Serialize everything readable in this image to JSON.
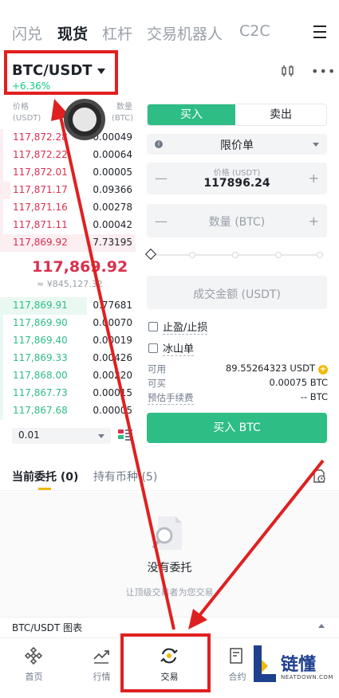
{
  "top_tabs": [
    "闪兑",
    "现货",
    "杠杆",
    "交易机器人",
    "C2C"
  ],
  "pair": {
    "symbol": "BTC/USDT",
    "change": "+6.36%"
  },
  "orderbook": {
    "price_header": "价格",
    "price_unit": "(USDT)",
    "qty_header": "数量",
    "qty_unit": "(BTC)",
    "asks": [
      {
        "price": "117,872.28",
        "qty": "0.00049"
      },
      {
        "price": "117,872.22",
        "qty": "0.00064"
      },
      {
        "price": "117,872.01",
        "qty": "0.00005"
      },
      {
        "price": "117,871.17",
        "qty": "0.09366"
      },
      {
        "price": "117,871.16",
        "qty": "0.00278"
      },
      {
        "price": "117,871.11",
        "qty": "0.00042"
      },
      {
        "price": "117,869.92",
        "qty": "7.73195"
      }
    ],
    "last_price": "117,869.92",
    "last_price_fiat": "≈ ¥845,127.32",
    "bids": [
      {
        "price": "117,869.91",
        "qty": "0.77681"
      },
      {
        "price": "117,869.90",
        "qty": "0.00070"
      },
      {
        "price": "117,869.40",
        "qty": "0.00019"
      },
      {
        "price": "117,869.33",
        "qty": "0.00426"
      },
      {
        "price": "117,868.00",
        "qty": "0.00220"
      },
      {
        "price": "117,867.73",
        "qty": "0.00015"
      },
      {
        "price": "117,867.68",
        "qty": "0.00005"
      }
    ],
    "depth": "0.01"
  },
  "trade_form": {
    "buy_tab": "买入",
    "sell_tab": "卖出",
    "order_type": "限价单",
    "price_label": "价格 (USDT)",
    "price_value": "117896.24",
    "quantity_placeholder": "数量 (BTC)",
    "total_placeholder": "成交金额 (USDT)",
    "tp_sl_label": "止盈/止损",
    "iceberg_label": "冰山单",
    "available_label": "可用",
    "available_value": "89.55264323 USDT",
    "can_buy_label": "可买",
    "can_buy_value": "0.00075 BTC",
    "fee_label": "预估手续费",
    "fee_value": "-- BTC",
    "buy_button": "买入 BTC"
  },
  "orders": {
    "open_tab": "当前委托 (0)",
    "holdings_tab": "持有币种 (5)",
    "empty_title": "没有委托",
    "empty_subtitle": "让顶级交易者为您交易"
  },
  "chart_bar_label": "BTC/USDT 图表",
  "bottom_nav": [
    "首页",
    "行情",
    "交易",
    "合约"
  ],
  "watermark": {
    "text": "链懂",
    "sub": "NEATDOWN.COM"
  },
  "colors": {
    "buy": "#2ebd85",
    "sell": "#d9304e",
    "accent": "#f0b90b",
    "annotation": "#e02020"
  }
}
